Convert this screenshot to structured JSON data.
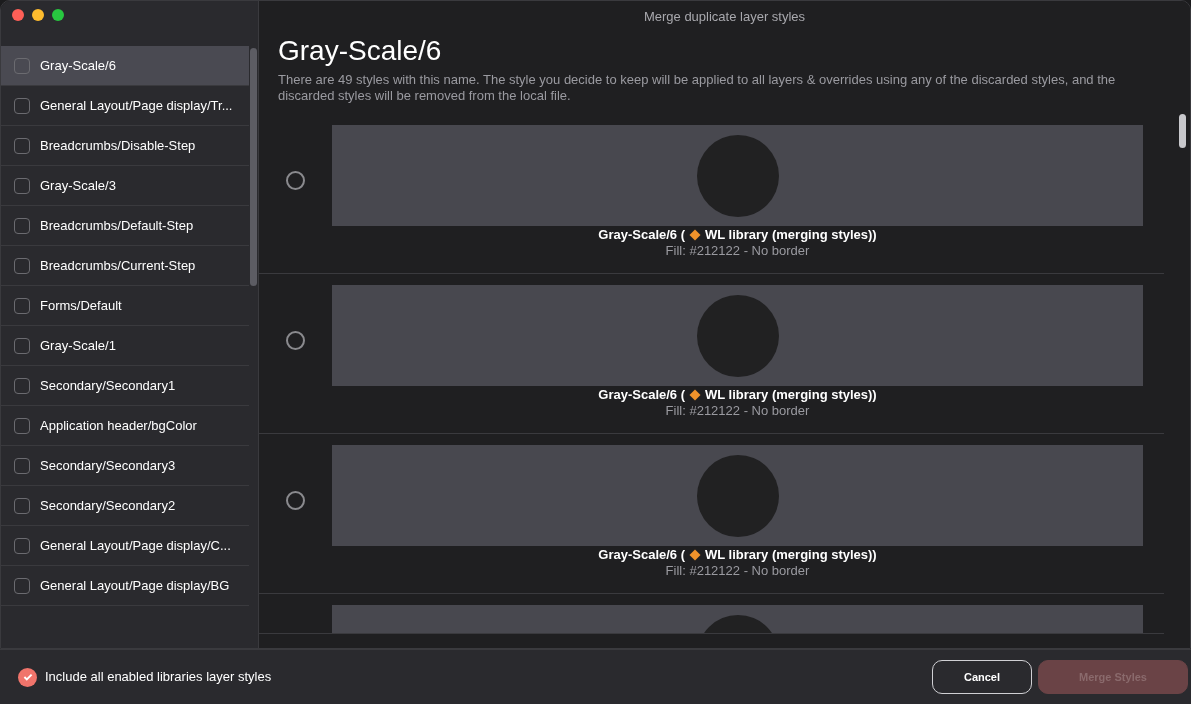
{
  "window": {
    "title": "Merge duplicate layer styles"
  },
  "sidebar": {
    "items": [
      {
        "label": "Gray-Scale/6",
        "checked": false,
        "selected": true
      },
      {
        "label": "General Layout/Page display/Tr...",
        "checked": false,
        "selected": false
      },
      {
        "label": "Breadcrumbs/Disable-Step",
        "checked": false,
        "selected": false
      },
      {
        "label": "Gray-Scale/3",
        "checked": false,
        "selected": false
      },
      {
        "label": "Breadcrumbs/Default-Step",
        "checked": false,
        "selected": false
      },
      {
        "label": "Breadcrumbs/Current-Step",
        "checked": false,
        "selected": false
      },
      {
        "label": "Forms/Default",
        "checked": false,
        "selected": false
      },
      {
        "label": "Gray-Scale/1",
        "checked": false,
        "selected": false
      },
      {
        "label": "Secondary/Secondary1",
        "checked": false,
        "selected": false
      },
      {
        "label": "Application header/bgColor",
        "checked": false,
        "selected": false
      },
      {
        "label": "Secondary/Secondary3",
        "checked": false,
        "selected": false
      },
      {
        "label": "Secondary/Secondary2",
        "checked": false,
        "selected": false
      },
      {
        "label": "General Layout/Page display/C...",
        "checked": false,
        "selected": false
      },
      {
        "label": "General Layout/Page display/BG",
        "checked": false,
        "selected": false
      }
    ]
  },
  "main": {
    "heading": "Gray-Scale/6",
    "description": "There are 49 styles with this name. The style you decide to keep will be applied to all layers & overrides using any of the discarded styles, and the discarded styles will be removed from the local file.",
    "styles": [
      {
        "selected": false,
        "name": "Gray-Scale/6 (",
        "library": "WL library (merging styles))",
        "details": "Fill: #212122 - No border"
      },
      {
        "selected": false,
        "name": "Gray-Scale/6 (",
        "library": "WL library (merging styles))",
        "details": "Fill: #212122 - No border"
      },
      {
        "selected": false,
        "name": "Gray-Scale/6 (",
        "library": "WL library (merging styles))",
        "details": "Fill: #212122 - No border"
      },
      {
        "kind": "partial"
      }
    ]
  },
  "footer": {
    "include_libraries": {
      "label": "Include all enabled libraries layer styles",
      "checked": true
    },
    "buttons": [
      {
        "label": "Cancel",
        "kind": "secondary",
        "disabled": false
      },
      {
        "label": "Merge Styles",
        "kind": "primary",
        "disabled": true
      }
    ]
  }
}
